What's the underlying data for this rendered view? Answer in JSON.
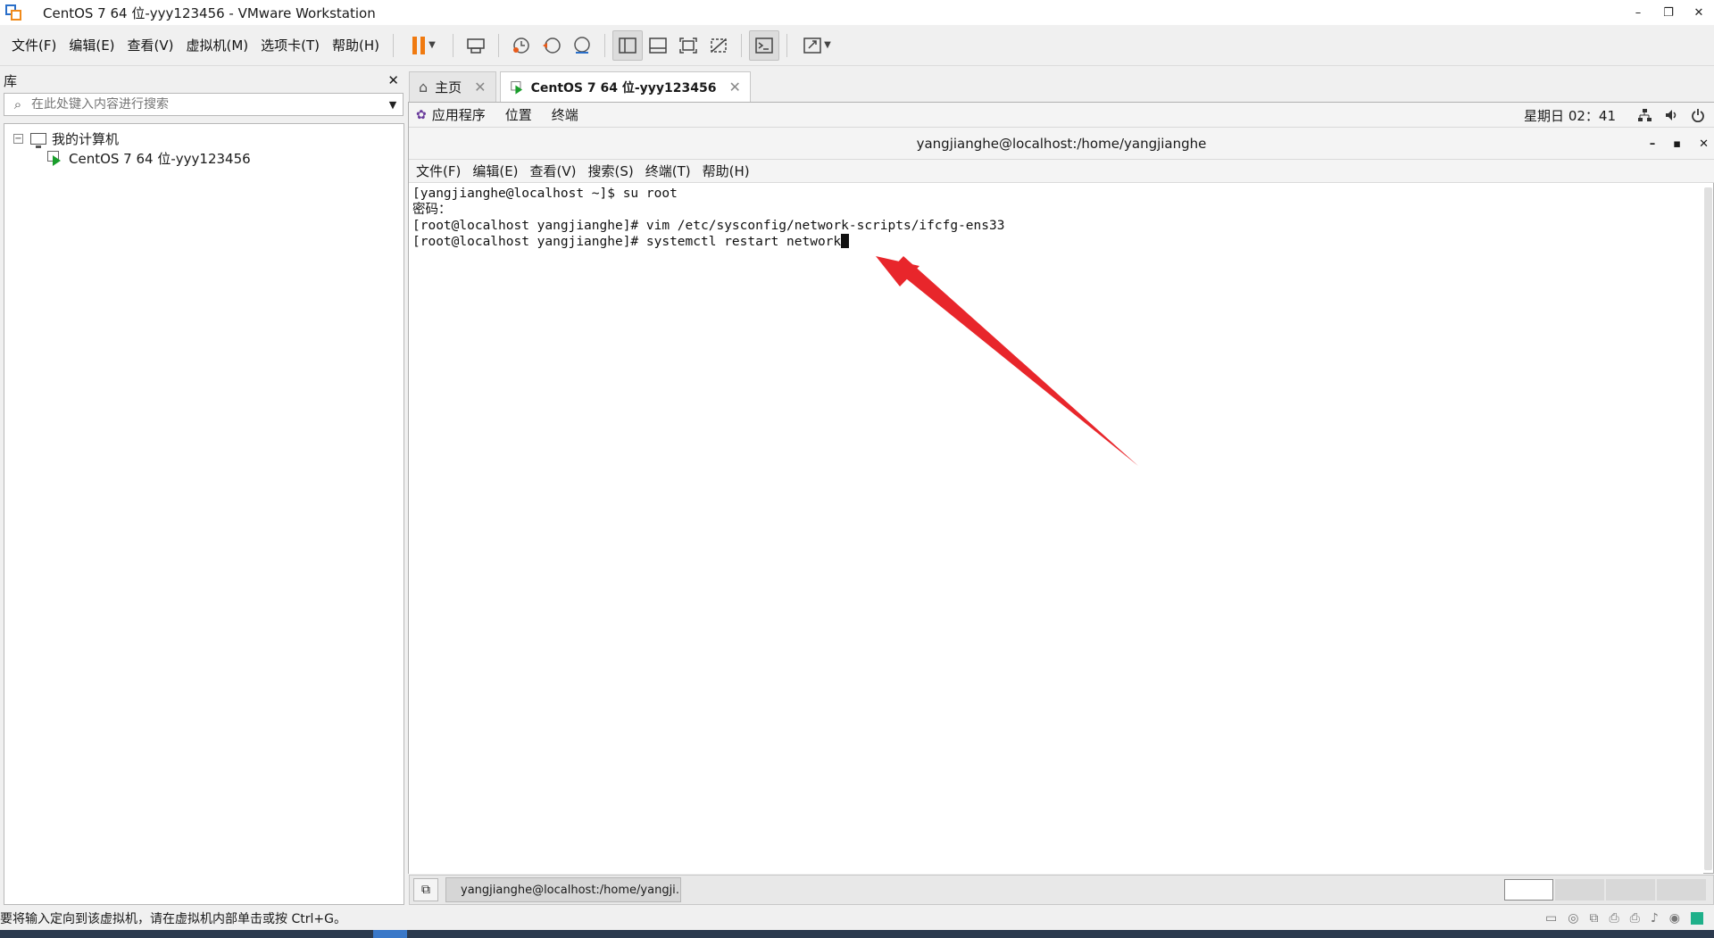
{
  "window": {
    "title": "CentOS 7 64 位-yyy123456 - VMware Workstation",
    "minimize": "–",
    "restore": "❐",
    "close": "✕"
  },
  "menu": [
    "文件(F)",
    "编辑(E)",
    "查看(V)",
    "虚拟机(M)",
    "选项卡(T)",
    "帮助(H)"
  ],
  "library": {
    "title": "库",
    "close": "✕",
    "search_placeholder": "在此处键入内容进行搜索",
    "root_label": "我的计算机",
    "vm_label": "CentOS 7 64 位-yyy123456"
  },
  "tabs": {
    "home_label": "主页",
    "vm_label": "CentOS 7 64 位-yyy123456",
    "close": "✕"
  },
  "guest_panel": {
    "applications": "应用程序",
    "places": "位置",
    "terminal": "终端",
    "clock": "星期日 02：41"
  },
  "terminal": {
    "title": "yangjianghe@localhost:/home/yangjianghe",
    "menu": [
      "文件(F)",
      "编辑(E)",
      "查看(V)",
      "搜索(S)",
      "终端(T)",
      "帮助(H)"
    ],
    "lines": [
      "[yangjianghe@localhost ~]$ su root",
      "密码：",
      "[root@localhost yangjianghe]# vim /etc/sysconfig/network-scripts/ifcfg-ens33",
      "[root@localhost yangjianghe]# systemctl restart network"
    ]
  },
  "taskbar": {
    "task_label": "yangjianghe@localhost:/home/yangji…"
  },
  "status": {
    "message": "要将输入定向到该虚拟机，请在虚拟机内部单击或按 Ctrl+G。"
  },
  "colors": {
    "accent": "#f07a10",
    "arrow": "#e8262b",
    "vm_play": "#1a9e2c"
  }
}
